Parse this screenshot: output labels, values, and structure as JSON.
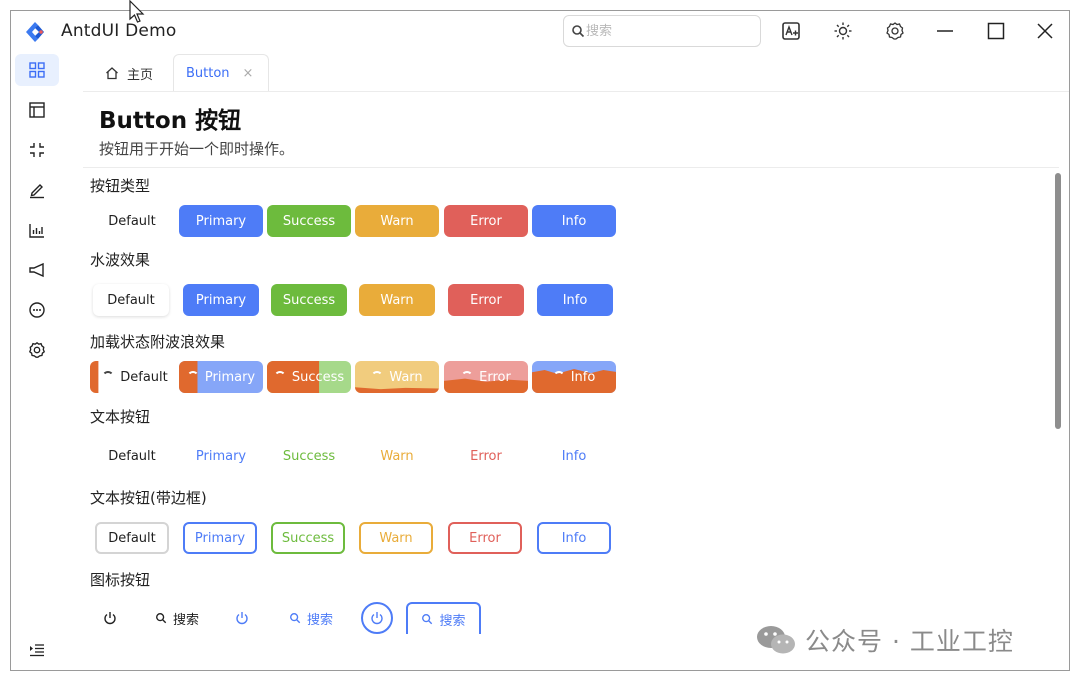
{
  "app": {
    "title": "AntdUI  Demo"
  },
  "search": {
    "placeholder": "搜索"
  },
  "tabs": [
    {
      "label": "主页",
      "icon": "home-icon"
    },
    {
      "label": "Button",
      "close": "×"
    }
  ],
  "page": {
    "title": "Button 按钮",
    "description": "按钮用于开始一个即时操作。"
  },
  "sections": {
    "types": "按钮类型",
    "ripple": "水波效果",
    "loading": "加载状态附波浪效果",
    "text": "文本按钮",
    "text_bordered": "文本按钮(带边框)",
    "icon": "图标按钮"
  },
  "buttons": {
    "default": "Default",
    "primary": "Primary",
    "success": "Success",
    "warn": "Warn",
    "error": "Error",
    "info": "Info"
  },
  "icon_buttons": {
    "search_label": "搜索"
  },
  "loading_progress": [
    0.15,
    0.15,
    0.55,
    0.1,
    0.4,
    0.7
  ],
  "colors": {
    "primary": "#4e7cf7",
    "success": "#6dbb3d",
    "warn": "#e9ac3a",
    "error": "#e0605a",
    "info": "#4e7cf7",
    "wave": "#e0692e",
    "active_tab": "#3c6ef6"
  },
  "sidebar": {
    "items": [
      "dashboard-icon",
      "layout-icon",
      "compress-icon",
      "edit-icon",
      "chart-icon",
      "megaphone-icon",
      "chat-icon",
      "gear-icon"
    ],
    "collapse": "collapse-menu-icon"
  },
  "watermark": {
    "text": "公众号 · 工业工控"
  }
}
